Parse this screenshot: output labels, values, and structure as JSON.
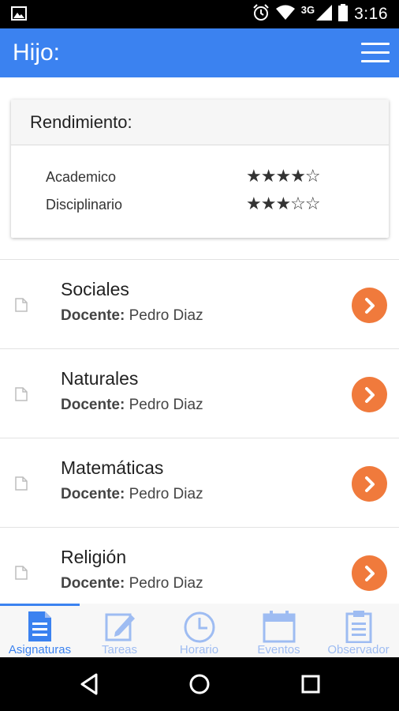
{
  "status_bar": {
    "time": "3:16",
    "network": "3G",
    "icons": [
      "image-notification-icon",
      "alarm-icon",
      "wifi-icon",
      "signal-icon",
      "battery-icon"
    ]
  },
  "app_bar": {
    "title": "Hijo:",
    "menu_icon": "hamburger-menu-icon",
    "color": "#3b82f0"
  },
  "performance": {
    "title": "Rendimiento:",
    "rows": [
      {
        "label": "Academico",
        "stars": "★★★★☆",
        "rating": 4,
        "max": 5
      },
      {
        "label": "Disciplinario",
        "stars": "★★★☆☆",
        "rating": 3,
        "max": 5
      }
    ]
  },
  "subjects": {
    "teacher_label": "Docente:",
    "accent": "#f07a3c",
    "items": [
      {
        "name": "Sociales",
        "teacher": "Pedro Diaz"
      },
      {
        "name": "Naturales",
        "teacher": "Pedro Diaz"
      },
      {
        "name": "Matemáticas",
        "teacher": "Pedro Diaz"
      },
      {
        "name": "Religión",
        "teacher": "Pedro Diaz"
      }
    ]
  },
  "tabs": [
    {
      "label": "Asignaturas",
      "icon": "document-icon",
      "active": true
    },
    {
      "label": "Tareas",
      "icon": "edit-icon",
      "active": false
    },
    {
      "label": "Horario",
      "icon": "clock-icon",
      "active": false
    },
    {
      "label": "Eventos",
      "icon": "calendar-icon",
      "active": false
    },
    {
      "label": "Observador",
      "icon": "clipboard-icon",
      "active": false
    }
  ],
  "nav_bar": {
    "buttons": [
      "back-icon",
      "home-icon",
      "recents-icon"
    ]
  }
}
